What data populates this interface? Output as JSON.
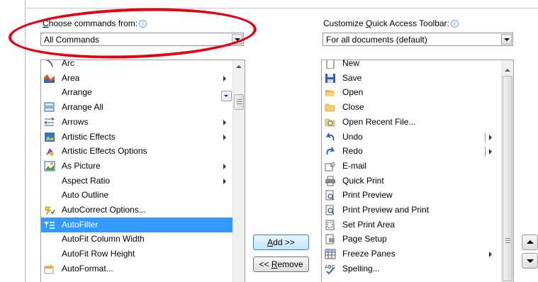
{
  "left_panel": {
    "label": "Choose commands from:",
    "label_access_key": "C",
    "dropdown_value": "All Commands",
    "items": [
      {
        "label": "Arc",
        "icon": "arc-icon",
        "submenu": false
      },
      {
        "label": "Area",
        "icon": "area-chart-icon",
        "submenu": true
      },
      {
        "label": "Arrange",
        "icon": "",
        "submenu": false,
        "dropdown": true
      },
      {
        "label": "Arrange All",
        "icon": "arrange-all-icon",
        "submenu": false
      },
      {
        "label": "Arrows",
        "icon": "arrows-icon",
        "submenu": true
      },
      {
        "label": "Artistic Effects",
        "icon": "artistic-effects-icon",
        "submenu": true
      },
      {
        "label": "Artistic Effects Options",
        "icon": "artistic-effects-options-icon",
        "submenu": false
      },
      {
        "label": "As Picture",
        "icon": "as-picture-icon",
        "submenu": true
      },
      {
        "label": "Aspect Ratio",
        "icon": "",
        "submenu": true
      },
      {
        "label": "Auto Outline",
        "icon": "",
        "submenu": false
      },
      {
        "label": "AutoCorrect Options...",
        "icon": "autocorrect-icon",
        "submenu": false
      },
      {
        "label": "AutoFilter",
        "icon": "autofilter-icon",
        "submenu": false,
        "selected": true
      },
      {
        "label": "AutoFit Column Width",
        "icon": "",
        "submenu": false
      },
      {
        "label": "AutoFit Row Height",
        "icon": "",
        "submenu": false
      },
      {
        "label": "AutoFormat...",
        "icon": "autoformat-icon",
        "submenu": false
      }
    ]
  },
  "right_panel": {
    "label": "Customize Quick Access Toolbar:",
    "label_access_key": "Q",
    "dropdown_value": "For all documents (default)",
    "items": [
      {
        "label": "New",
        "icon": "new-document-icon",
        "submenu": false
      },
      {
        "label": "Save",
        "icon": "save-icon",
        "submenu": false
      },
      {
        "label": "Open",
        "icon": "open-folder-icon",
        "submenu": false
      },
      {
        "label": "Close",
        "icon": "close-folder-icon",
        "submenu": false
      },
      {
        "label": "Open Recent File...",
        "icon": "recent-file-icon",
        "submenu": false
      },
      {
        "label": "Undo",
        "icon": "undo-icon",
        "submenu": true,
        "split": true
      },
      {
        "label": "Redo",
        "icon": "redo-icon",
        "submenu": true,
        "split": true
      },
      {
        "label": "E-mail",
        "icon": "email-icon",
        "submenu": false
      },
      {
        "label": "Quick Print",
        "icon": "quick-print-icon",
        "submenu": false
      },
      {
        "label": "Print Preview",
        "icon": "print-preview-icon",
        "submenu": false
      },
      {
        "label": "Print Preview and Print",
        "icon": "print-preview-and-print-icon",
        "submenu": false
      },
      {
        "label": "Set Print Area",
        "icon": "set-print-area-icon",
        "submenu": false
      },
      {
        "label": "Page Setup",
        "icon": "page-setup-icon",
        "submenu": false
      },
      {
        "label": "Freeze Panes",
        "icon": "freeze-panes-icon",
        "submenu": true
      },
      {
        "label": "Spelling...",
        "icon": "spelling-icon",
        "submenu": false
      }
    ]
  },
  "buttons": {
    "add": "Add >>",
    "remove": "<< Remove"
  },
  "colors": {
    "selection": "#3399ff",
    "annotation_ellipse": "#e3000f",
    "info_icon": "#4a86c8"
  }
}
